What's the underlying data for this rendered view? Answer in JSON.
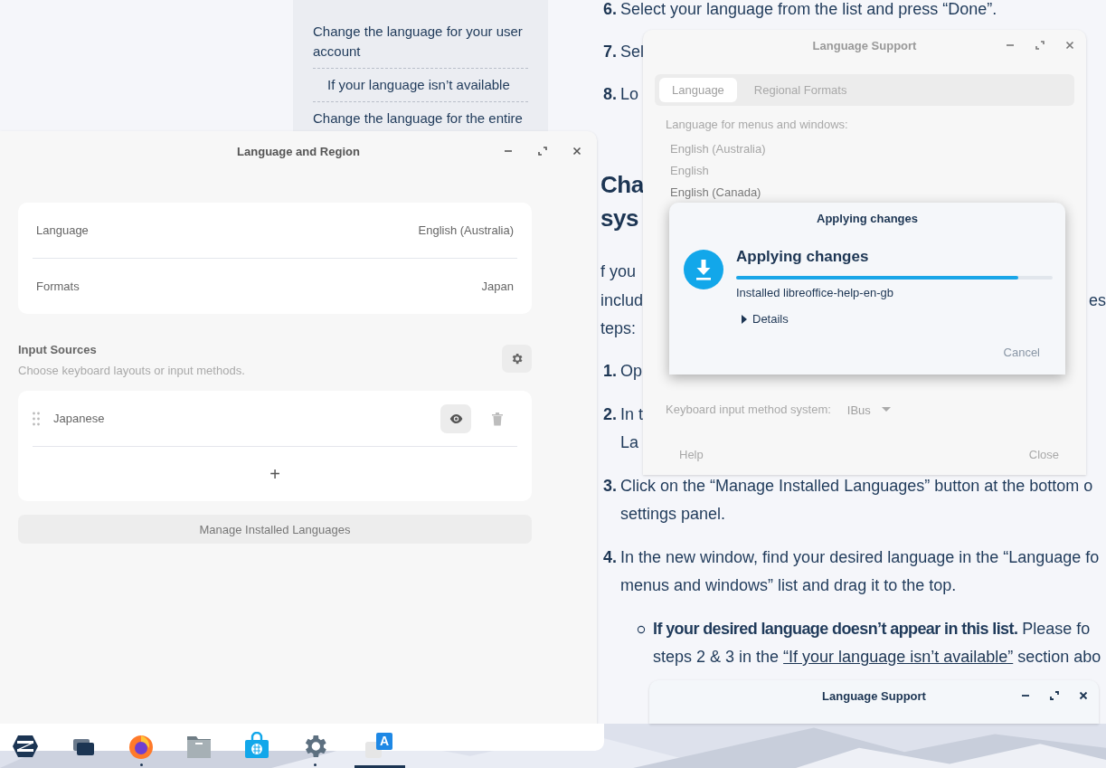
{
  "web_page": {
    "sidebar_links": [
      {
        "text": "Change the language for your user account",
        "indented": false
      },
      {
        "text": "If your language isn’t available",
        "indented": true
      },
      {
        "text": "Change the language for the entire",
        "indented": false
      }
    ],
    "steps_top": [
      {
        "number": "6.",
        "text": "Select your language from the list and press “Done”."
      },
      {
        "number": "7.",
        "text": "Sel"
      },
      {
        "number": "8.",
        "text": "Lo"
      }
    ],
    "heading_lines": [
      "Cha",
      "sys"
    ],
    "intro_lines": [
      {
        "left": "f you"
      },
      {
        "left": "includ",
        "right": "es"
      },
      {
        "left": "teps:"
      }
    ],
    "steps": [
      {
        "number": "1.",
        "lines": [
          "Op"
        ]
      },
      {
        "number": "2.",
        "lines": [
          "In t",
          "La"
        ]
      },
      {
        "number": "3.",
        "lines": [
          "Click on the “Manage Installed Languages” button at the bottom o",
          "settings panel."
        ]
      },
      {
        "number": "4.",
        "lines": [
          "In the new window, find your desired language in the “Language fo",
          "menus and windows” list and drag it to the top."
        ]
      }
    ],
    "bullet": {
      "first_line": "**If your desired language doesn’t appear in this list.** Please fo",
      "second_line_before": "steps 2 & 3 in the",
      "link": "“If your language isn’t available”",
      "second_line_after": "section abo"
    }
  },
  "language_and_region": {
    "title": "Language and Region",
    "settings": [
      {
        "label": "Language",
        "value": "English (Australia)"
      },
      {
        "label": "Formats",
        "value": "Japan"
      }
    ],
    "input_sources": {
      "title": "Input Sources",
      "subtitle": "Choose keyboard layouts or input methods.",
      "sources": [
        {
          "name": "Japanese"
        }
      ],
      "add_label": "+"
    },
    "manage_button": "Manage Installed Languages"
  },
  "language_support": {
    "title": "Language Support",
    "active": false,
    "tabs": [
      {
        "label": "Language",
        "selected": true
      },
      {
        "label": "Regional Formats",
        "selected": false
      }
    ],
    "list_label": "Language for menus and windows:",
    "languages": [
      {
        "name": "English (Australia)",
        "selected": false
      },
      {
        "name": "English",
        "selected": false
      },
      {
        "name": "English (Canada)",
        "selected": true
      }
    ],
    "input_method_label": "Keyboard input method system:",
    "input_method": "IBus",
    "buttons": [
      "Help",
      "Close"
    ]
  },
  "dialog": {
    "title": "Applying changes",
    "heading": "Applying changes",
    "level": 0.89,
    "status": "Installed libreoffice-help-en-gb",
    "details": {
      "label": "Details",
      "expanded": false
    },
    "cancel": "Cancel"
  },
  "language_support_2": {
    "title": "Language Support",
    "active": true
  },
  "taskbar": [
    {
      "kind": "logo",
      "running": false,
      "active": false
    },
    {
      "kind": "windows",
      "running": false,
      "active": false
    },
    {
      "kind": "browser",
      "running": true,
      "active": false
    },
    {
      "kind": "folder",
      "running": false,
      "active": false
    },
    {
      "kind": "store",
      "running": false,
      "active": false
    },
    {
      "kind": "settings",
      "running": true,
      "active": false
    },
    {
      "kind": "language",
      "glyph": "A",
      "running": false,
      "active": true
    }
  ]
}
